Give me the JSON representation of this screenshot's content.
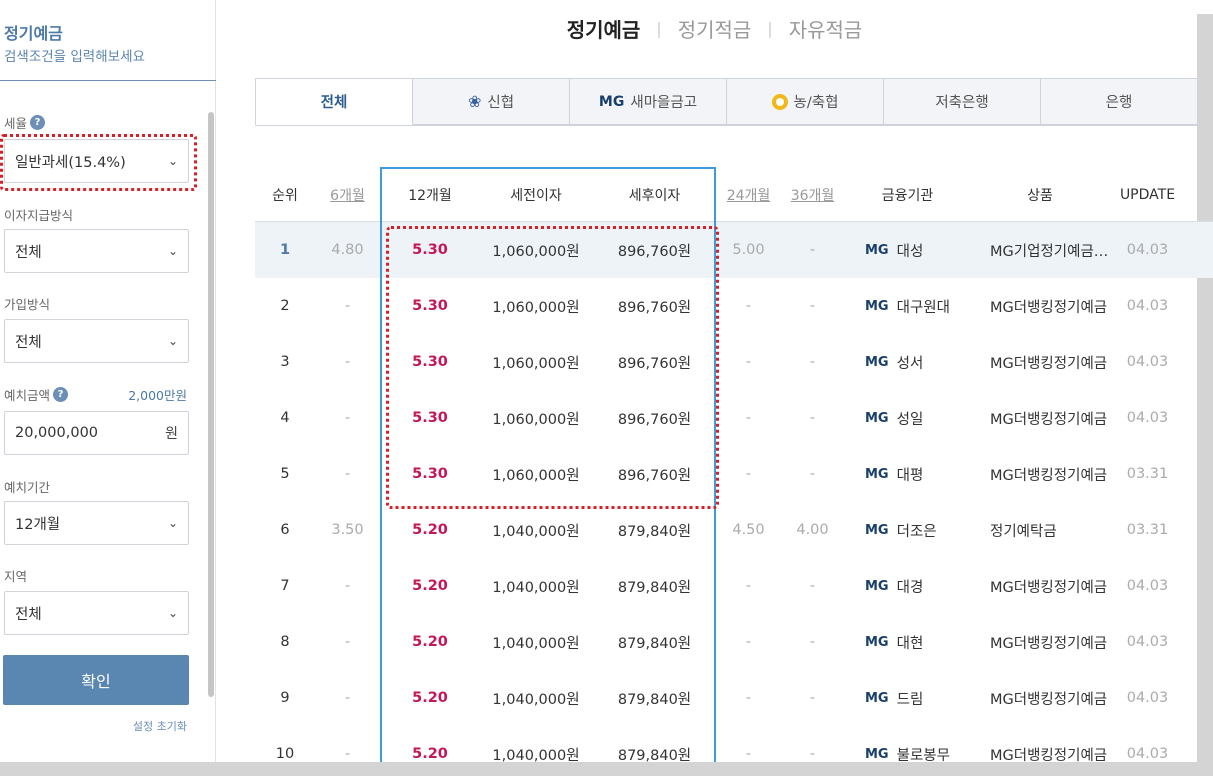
{
  "sidebar": {
    "title": "정기예금",
    "subtitle": "검색조건을 입력해보세요",
    "tax_label": "세율",
    "tax_value": "일반과세(15.4%)",
    "payment_label": "이자지급방식",
    "payment_value": "전체",
    "join_label": "가입방식",
    "join_value": "전체",
    "deposit_label": "예치금액",
    "deposit_hint": "2,000만원",
    "deposit_value": "20,000,000",
    "deposit_unit": "원",
    "period_label": "예치기간",
    "period_value": "12개월",
    "region_label": "지역",
    "region_value": "전체",
    "confirm_label": "확인",
    "reset_label": "설정 초기화",
    "help_icon": "?"
  },
  "topnav": [
    "정기예금",
    "정기적금",
    "자유적금"
  ],
  "tabs": [
    "전체",
    "신협",
    "새마을금고",
    "농/축협",
    "저축은행",
    "은행"
  ],
  "tab_icons": {
    "mg": "MG"
  },
  "table": {
    "headers": {
      "rank": "순위",
      "m6": "6개월",
      "m12": "12개월",
      "pre": "세전이자",
      "post": "세후이자",
      "m24": "24개월",
      "m36": "36개월",
      "inst": "금융기관",
      "prod": "상품",
      "upd": "UPDATE"
    },
    "rows": [
      {
        "rank": "1",
        "m6": "4.80",
        "m12": "5.30",
        "pre": "1,060,000원",
        "post": "896,760원",
        "m24": "5.00",
        "m36": "-",
        "inst": "대성",
        "prod": "MG기업정기예금…",
        "upd": "04.03"
      },
      {
        "rank": "2",
        "m6": "-",
        "m12": "5.30",
        "pre": "1,060,000원",
        "post": "896,760원",
        "m24": "-",
        "m36": "-",
        "inst": "대구원대",
        "prod": "MG더뱅킹정기예금",
        "upd": "04.03"
      },
      {
        "rank": "3",
        "m6": "-",
        "m12": "5.30",
        "pre": "1,060,000원",
        "post": "896,760원",
        "m24": "-",
        "m36": "-",
        "inst": "성서",
        "prod": "MG더뱅킹정기예금",
        "upd": "04.03"
      },
      {
        "rank": "4",
        "m6": "-",
        "m12": "5.30",
        "pre": "1,060,000원",
        "post": "896,760원",
        "m24": "-",
        "m36": "-",
        "inst": "성일",
        "prod": "MG더뱅킹정기예금",
        "upd": "04.03"
      },
      {
        "rank": "5",
        "m6": "-",
        "m12": "5.30",
        "pre": "1,060,000원",
        "post": "896,760원",
        "m24": "-",
        "m36": "-",
        "inst": "대평",
        "prod": "MG더뱅킹정기예금",
        "upd": "03.31"
      },
      {
        "rank": "6",
        "m6": "3.50",
        "m12": "5.20",
        "pre": "1,040,000원",
        "post": "879,840원",
        "m24": "4.50",
        "m36": "4.00",
        "inst": "더조은",
        "prod": "정기예탁금",
        "upd": "03.31"
      },
      {
        "rank": "7",
        "m6": "-",
        "m12": "5.20",
        "pre": "1,040,000원",
        "post": "879,840원",
        "m24": "-",
        "m36": "-",
        "inst": "대경",
        "prod": "MG더뱅킹정기예금",
        "upd": "04.03"
      },
      {
        "rank": "8",
        "m6": "-",
        "m12": "5.20",
        "pre": "1,040,000원",
        "post": "879,840원",
        "m24": "-",
        "m36": "-",
        "inst": "대현",
        "prod": "MG더뱅킹정기예금",
        "upd": "04.03"
      },
      {
        "rank": "9",
        "m6": "-",
        "m12": "5.20",
        "pre": "1,040,000원",
        "post": "879,840원",
        "m24": "-",
        "m36": "-",
        "inst": "드림",
        "prod": "MG더뱅킹정기예금",
        "upd": "04.03"
      },
      {
        "rank": "10",
        "m6": "-",
        "m12": "5.20",
        "pre": "1,040,000원",
        "post": "879,840원",
        "m24": "-",
        "m36": "-",
        "inst": "불로봉무",
        "prod": "MG더뱅킹정기예금",
        "upd": "04.03"
      }
    ]
  },
  "colors": {
    "accent": "#5a87b1",
    "rate": "#c2185b",
    "highlight_red": "#d91f26",
    "highlight_blue": "#3f9be0"
  }
}
